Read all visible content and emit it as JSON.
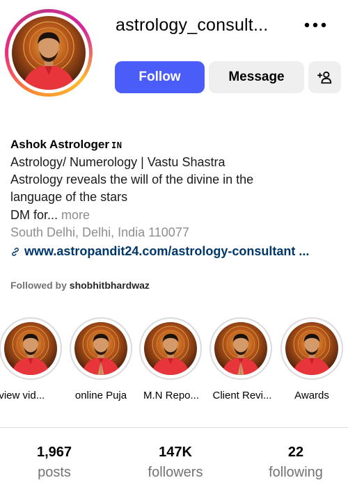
{
  "profile": {
    "username": "astrology_consult...",
    "more_icon": "more-horizontal-icon",
    "follow_label": "Follow",
    "message_label": "Message",
    "add_user_icon": "person-add-icon"
  },
  "bio": {
    "name": "Ashok Astrologer",
    "pronoun_badge": "IN",
    "lines": [
      "Astrology/ Numerology | Vastu Shastra",
      "Astrology reveals the will of the divine in the",
      "language of the stars"
    ],
    "truncated": "DM for...",
    "more_label": "more",
    "location": "South Delhi, Delhi, India 110077",
    "link": "www.astropandit24.com/astrology-consultant ..."
  },
  "followed_by": {
    "prefix": "Followed by",
    "user": "shobhitbhardwaz"
  },
  "highlights": [
    {
      "label": "eview vid..."
    },
    {
      "label": "online Puja"
    },
    {
      "label": "M.N Repo..."
    },
    {
      "label": "Client Revi..."
    },
    {
      "label": "Awards"
    }
  ],
  "stats": {
    "posts": {
      "value": "1,967",
      "label": "posts"
    },
    "followers": {
      "value": "147K",
      "label": "followers"
    },
    "following": {
      "value": "22",
      "label": "following"
    }
  },
  "colors": {
    "follow_button": "#4a5df9",
    "secondary_button": "#efefef",
    "link": "#00376b",
    "shirt": "#e8343b"
  }
}
